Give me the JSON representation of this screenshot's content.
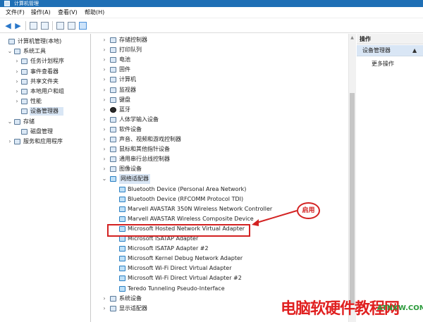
{
  "window": {
    "title": "计算机管理"
  },
  "menu": [
    "文件(F)",
    "操作(A)",
    "查看(V)",
    "帮助(H)"
  ],
  "toolbar": {
    "back_icon": "back-arrow-icon",
    "forward_icon": "forward-arrow-icon"
  },
  "left_tree": [
    {
      "label": "计算机管理(本地)",
      "caret": "",
      "icon": "computer-management-icon"
    },
    {
      "label": "系统工具",
      "caret": "⌄",
      "icon": "tools-icon"
    },
    {
      "label": "任务计划程序",
      "caret": "›",
      "icon": "task-scheduler-icon"
    },
    {
      "label": "事件查看器",
      "caret": "›",
      "icon": "event-viewer-icon"
    },
    {
      "label": "共享文件夹",
      "caret": "›",
      "icon": "shared-folder-icon"
    },
    {
      "label": "本地用户和组",
      "caret": "›",
      "icon": "users-icon"
    },
    {
      "label": "性能",
      "caret": "›",
      "icon": "performance-icon"
    },
    {
      "label": "设备管理器",
      "caret": "",
      "icon": "device-manager-icon"
    },
    {
      "label": "存储",
      "caret": "⌄",
      "icon": "storage-icon"
    },
    {
      "label": "磁盘管理",
      "caret": "",
      "icon": "disk-icon"
    },
    {
      "label": "服务和应用程序",
      "caret": "›",
      "icon": "services-icon"
    }
  ],
  "device_tree": [
    {
      "label": "存储控制器",
      "caret": "›",
      "icon": "storage-controller-icon"
    },
    {
      "label": "打印队列",
      "caret": "›",
      "icon": "printer-icon"
    },
    {
      "label": "电池",
      "caret": "›",
      "icon": "battery-icon"
    },
    {
      "label": "固件",
      "caret": "›",
      "icon": "firmware-icon"
    },
    {
      "label": "计算机",
      "caret": "›",
      "icon": "computer-icon"
    },
    {
      "label": "监视器",
      "caret": "›",
      "icon": "monitor-icon"
    },
    {
      "label": "键盘",
      "caret": "›",
      "icon": "keyboard-icon"
    },
    {
      "label": "蓝牙",
      "caret": "›",
      "icon": "bluetooth-icon"
    },
    {
      "label": "人体学输入设备",
      "caret": "›",
      "icon": "hid-icon"
    },
    {
      "label": "软件设备",
      "caret": "›",
      "icon": "software-device-icon"
    },
    {
      "label": "声音、视频和游戏控制器",
      "caret": "›",
      "icon": "sound-icon"
    },
    {
      "label": "鼠标和其他指针设备",
      "caret": "›",
      "icon": "mouse-icon"
    },
    {
      "label": "通用串行总线控制器",
      "caret": "›",
      "icon": "usb-icon"
    },
    {
      "label": "图像设备",
      "caret": "›",
      "icon": "camera-icon"
    },
    {
      "label": "网络适配器",
      "caret": "⌄",
      "icon": "network-adapter-icon"
    },
    {
      "label": "Bluetooth Device (Personal Area Network)",
      "caret": "",
      "icon": "network-adapter-icon"
    },
    {
      "label": "Bluetooth Device (RFCOMM Protocol TDI)",
      "caret": "",
      "icon": "network-adapter-icon"
    },
    {
      "label": "Marvell AVASTAR 350N Wireless Network Controller",
      "caret": "",
      "icon": "network-adapter-icon"
    },
    {
      "label": "Marvell AVASTAR Wireless Composite Device",
      "caret": "",
      "icon": "network-adapter-icon"
    },
    {
      "label": "Microsoft Hosted Network Virtual Adapter",
      "caret": "",
      "icon": "network-adapter-icon"
    },
    {
      "label": "Microsoft ISATAP Adapter",
      "caret": "",
      "icon": "network-adapter-icon"
    },
    {
      "label": "Microsoft ISATAP Adapter #2",
      "caret": "",
      "icon": "network-adapter-icon"
    },
    {
      "label": "Microsoft Kernel Debug Network Adapter",
      "caret": "",
      "icon": "network-adapter-icon"
    },
    {
      "label": "Microsoft Wi-Fi Direct Virtual Adapter",
      "caret": "",
      "icon": "network-adapter-icon"
    },
    {
      "label": "Microsoft Wi-Fi Direct Virtual Adapter #2",
      "caret": "",
      "icon": "network-adapter-icon"
    },
    {
      "label": "Teredo Tunneling Pseudo-Interface",
      "caret": "",
      "icon": "network-adapter-icon"
    },
    {
      "label": "系统设备",
      "caret": "›",
      "icon": "system-device-icon"
    },
    {
      "label": "显示适配器",
      "caret": "›",
      "icon": "display-adapter-icon"
    }
  ],
  "actions": {
    "header": "操作",
    "selected": "设备管理器",
    "more": "更多操作"
  },
  "annotation": {
    "badge": "启用"
  },
  "watermark": {
    "text": "电脑软硬件教程网",
    "sub": "ATNXW.COM"
  },
  "colors": {
    "accent": "#1f6fb5",
    "highlight": "#d32222",
    "watermark": "#e02020"
  }
}
